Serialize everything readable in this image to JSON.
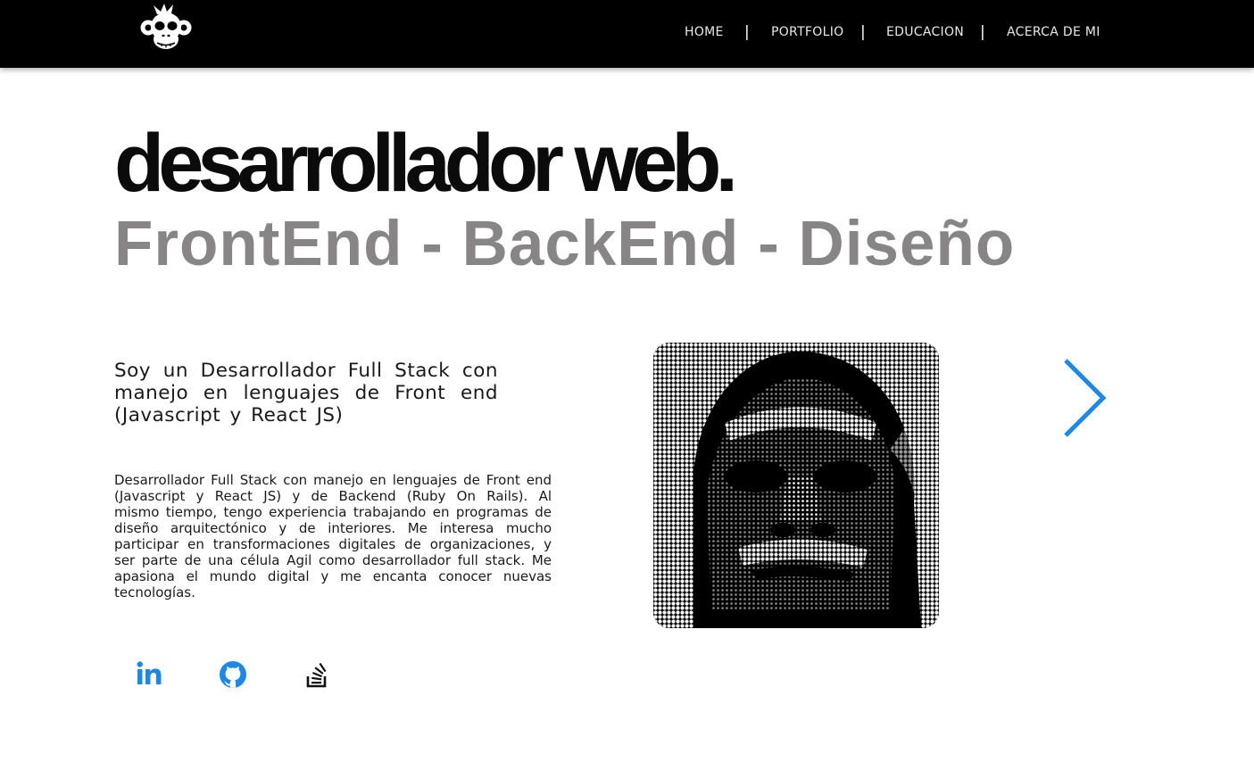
{
  "nav": {
    "links": [
      "HOME",
      "PORTFOLIO",
      "EDUCACION",
      "ACERCA DE MI"
    ],
    "separator": "|"
  },
  "hero": {
    "headline": "desarrollador web.",
    "subheadline": "FrontEnd - BackEnd - Diseño"
  },
  "about": {
    "intro": "Soy un Desarrollador Full Stack con manejo en lenguajes de Front end (Javascript y React JS)",
    "bio": "Desarrollador Full Stack con manejo en lenguajes de Front end (Javascript y React JS) y de Backend (Ruby On Rails). Al mismo tiempo, tengo experiencia trabajando en programas de diseño arquitectónico y de interiores. Me interesa mucho participar en transformaciones digitales de organizaciones, y ser parte de una célula Agil como desarrollador full stack. Me apasiona el mundo digital y me encanta conocer nuevas tecnologías."
  },
  "social": {
    "icons": [
      "linkedin-icon",
      "github-icon",
      "stackoverflow-icon"
    ]
  },
  "colors": {
    "navbar": "#000000",
    "headline": "#0b0b0b",
    "subheadline": "#888586",
    "accent": "#1e88e5"
  },
  "icons": {
    "logo": "monkey-skull-logo",
    "next": "chevron-right-icon"
  }
}
